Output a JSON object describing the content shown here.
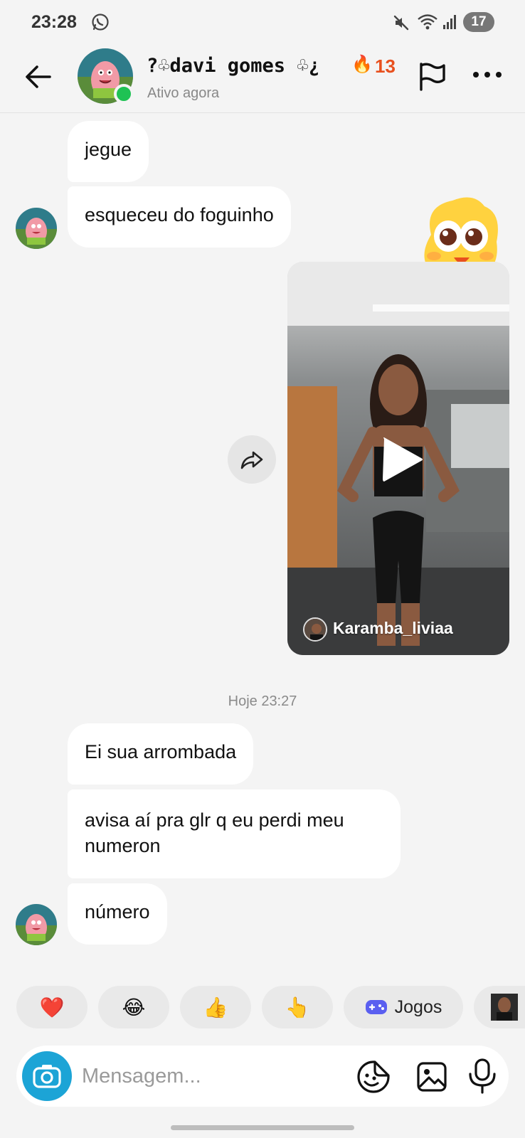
{
  "status_bar": {
    "time": "23:28",
    "battery_level": "17",
    "icons": [
      "whatsapp-icon",
      "mute-icon",
      "wifi-icon",
      "signal-icon"
    ]
  },
  "header": {
    "contact_name": "?♧davi gomes ♧¿",
    "streak_count": "13",
    "status": "Ativo agora",
    "icons": [
      "back-arrow-icon",
      "flag-icon",
      "more-icon"
    ]
  },
  "messages": {
    "m1": "jegue",
    "m2": "esqueceu do foguinho",
    "video": {
      "author": "Karamba_liviaa"
    },
    "timestamp": "Hoje 23:27",
    "m3": "Ei sua arrombada",
    "m4": "avisa aí pra glr q eu perdi meu numeron",
    "m5": "número"
  },
  "quick_replies": {
    "items": [
      "❤️",
      "😂",
      "👍",
      "👆"
    ],
    "games_label": "Jogos"
  },
  "composer": {
    "placeholder": "Mensagem..."
  },
  "colors": {
    "background": "#f4f4f4",
    "bubble": "#ffffff",
    "online": "#1fc254",
    "streak": "#e8501e",
    "camera": "#1ca4d6"
  }
}
